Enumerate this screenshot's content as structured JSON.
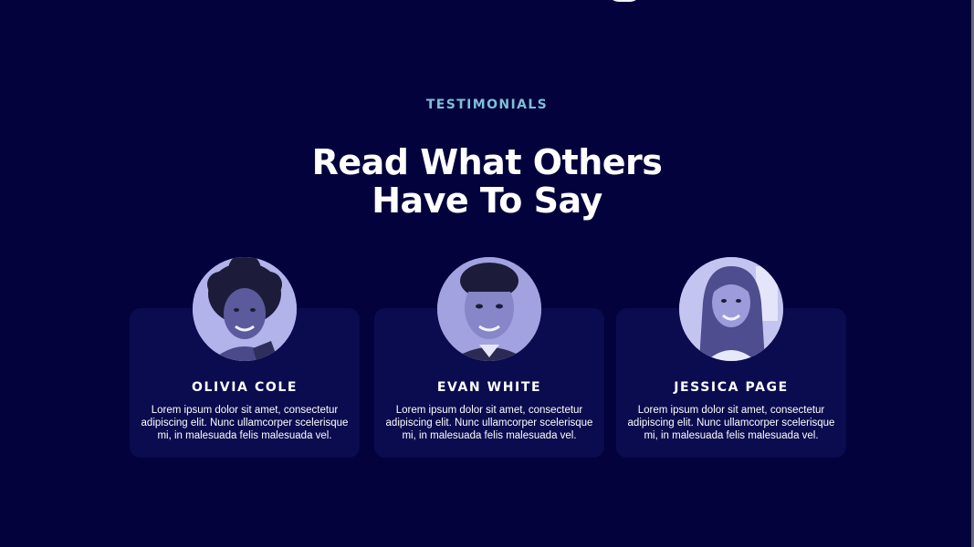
{
  "section": {
    "eyebrow": "TESTIMONIALS",
    "headline_line1": "Read What Others",
    "headline_line2": "Have To Say"
  },
  "testimonials": [
    {
      "name": "OLIVIA COLE",
      "quote": "Lorem ipsum dolor sit amet, consectetur adipiscing elit. Nunc ullamcorper scelerisque mi, in malesuada felis malesuada vel.",
      "avatar": "avatar-photo-icon"
    },
    {
      "name": "EVAN WHITE",
      "quote": "Lorem ipsum dolor sit amet, consectetur adipiscing elit. Nunc ullamcorper scelerisque mi, in malesuada felis malesuada vel.",
      "avatar": "avatar-photo-icon"
    },
    {
      "name": "JESSICA PAGE",
      "quote": "Lorem ipsum dolor sit amet, consectetur adipiscing elit. Nunc ullamcorper scelerisque mi, in malesuada felis malesuada vel.",
      "avatar": "avatar-photo-icon"
    }
  ],
  "colors": {
    "background": "#03023d",
    "card": "#0b0b4f",
    "eyebrow": "#7fbfd6",
    "text": "#ffffff",
    "avatar_tint": "#8f8fd6"
  }
}
